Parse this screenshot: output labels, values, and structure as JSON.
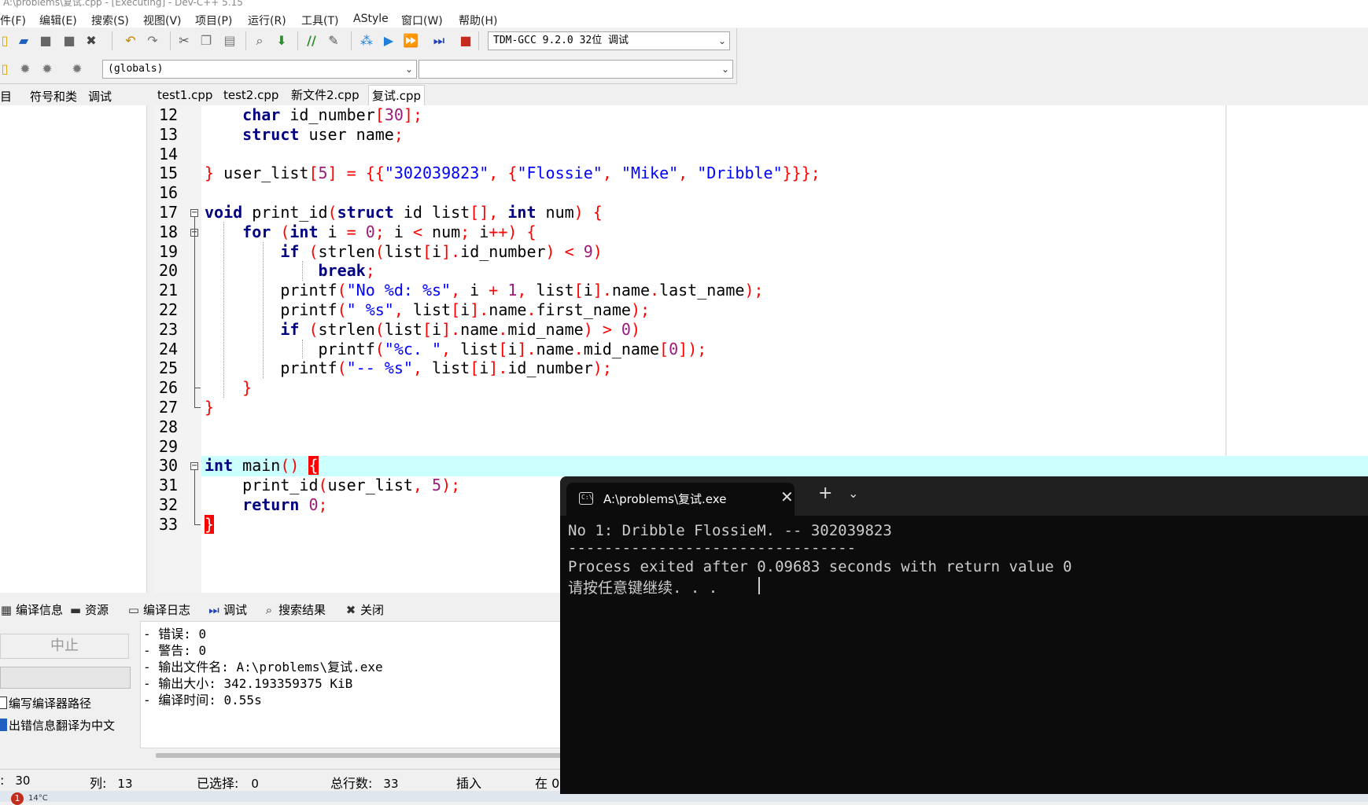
{
  "window": {
    "title": "A:\\problems\\复试.cpp - [Executing] - Dev-C++ 5.15"
  },
  "menu": {
    "items": [
      "件(F)",
      "编辑(E)",
      "搜索(S)",
      "视图(V)",
      "项目(P)",
      "运行(R)",
      "工具(T)",
      "AStyle",
      "窗口(W)",
      "帮助(H)"
    ]
  },
  "toolbar": {
    "compiler": "TDM-GCC 9.2.0 32位 调试",
    "scope": "(globals)",
    "member": ""
  },
  "left_tabs": [
    "目",
    "符号和类",
    "调试"
  ],
  "file_tabs": [
    {
      "label": "test1.cpp",
      "active": false
    },
    {
      "label": "test2.cpp",
      "active": false
    },
    {
      "label": "新文件2.cpp",
      "active": false
    },
    {
      "label": "复试.cpp",
      "active": true
    }
  ],
  "code": {
    "line_numbers": [
      "12",
      "13",
      "14",
      "15",
      "16",
      "17",
      "18",
      "19",
      "20",
      "21",
      "22",
      "23",
      "24",
      "25",
      "26",
      "27",
      "28",
      "29",
      "30",
      "31",
      "32",
      "33"
    ],
    "highlighted_line": "30",
    "lines": [
      "    char id_number[30];",
      "    struct user name;",
      "",
      "} user_list[5] = {{\"302039823\", {\"Flossie\", \"Mike\", \"Dribble\"}}};",
      "",
      "void print_id(struct id list[], int num) {",
      "    for (int i = 0; i < num; i++) {",
      "        if (strlen(list[i].id_number) < 9)",
      "            break;",
      "        printf(\"No %d: %s\", i + 1, list[i].name.last_name);",
      "        printf(\" %s\", list[i].name.first_name);",
      "        if (strlen(list[i].name.mid_name) > 0)",
      "            printf(\"%c. \", list[i].name.mid_name[0]);",
      "        printf(\"-- %s\", list[i].id_number);",
      "    }",
      "}",
      "",
      "",
      "int main() {",
      "    print_id(user_list, 5);",
      "    return 0;",
      "}"
    ]
  },
  "bottom_tabs": [
    {
      "label": "编译信息",
      "icon": "grid-icon"
    },
    {
      "label": "资源",
      "icon": "folder-icon"
    },
    {
      "label": "编译日志",
      "icon": "log-icon"
    },
    {
      "label": "调试",
      "icon": "debug-icon"
    },
    {
      "label": "搜索结果",
      "icon": "search-icon"
    },
    {
      "label": "关闭",
      "icon": "close-icon"
    }
  ],
  "bottom_left": {
    "stop_label": "中止",
    "check1": "编写编译器路径",
    "check2": "出错信息翻译为中文"
  },
  "log": [
    "- 错误: 0",
    "- 警告: 0",
    "- 输出文件名: A:\\problems\\复试.exe",
    "- 输出大小: 342.193359375 KiB",
    "- 编译时间: 0.55s"
  ],
  "status": {
    "line_label": ":",
    "line_value": "30",
    "col_label": "列:",
    "col_value": "13",
    "sel_label": "已选择:",
    "sel_value": "0",
    "total_label": "总行数:",
    "total_value": "33",
    "mode": "插入",
    "extra": "在 0"
  },
  "taskbar": {
    "badge": "1",
    "weather": "14°C"
  },
  "terminal": {
    "tab_title": "A:\\problems\\复试.exe",
    "lines": [
      "No 1: Dribble FlossieM. -- 302039823",
      "--------------------------------",
      "Process exited after 0.09683 seconds with return value 0",
      "请按任意键继续. . ."
    ]
  },
  "colors": {
    "keyword": "#000080",
    "string": "#0000ff",
    "number": "#9b1c7a",
    "punct": "#ff0000",
    "current_line": "#ccffff",
    "terminal_bg": "#0c0c0c"
  }
}
